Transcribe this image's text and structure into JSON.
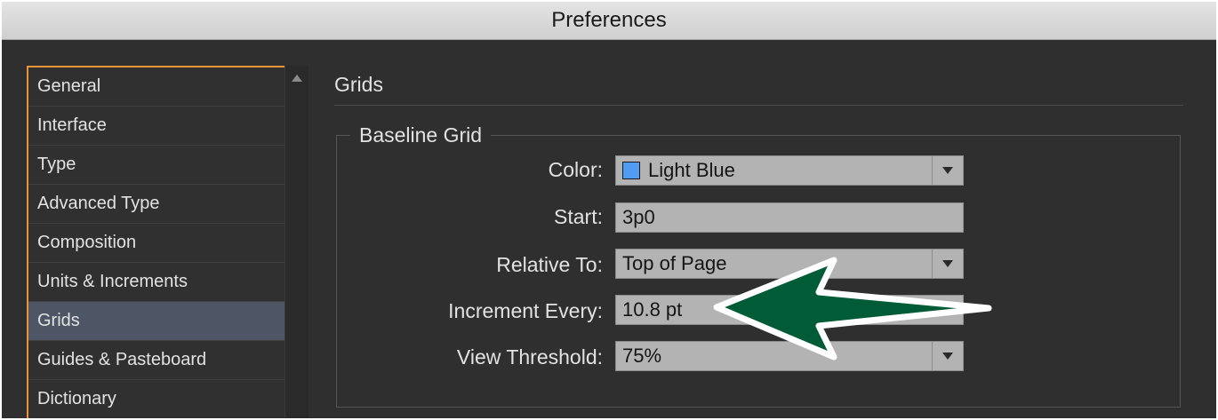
{
  "window": {
    "title": "Preferences"
  },
  "sidebar": {
    "items": [
      {
        "label": "General"
      },
      {
        "label": "Interface"
      },
      {
        "label": "Type"
      },
      {
        "label": "Advanced Type"
      },
      {
        "label": "Composition"
      },
      {
        "label": "Units & Increments"
      },
      {
        "label": "Grids"
      },
      {
        "label": "Guides & Pasteboard"
      },
      {
        "label": "Dictionary"
      }
    ],
    "selected": "Grids"
  },
  "panel": {
    "title": "Grids",
    "group_title": "Baseline Grid",
    "fields": {
      "color": {
        "label": "Color:",
        "value": "Light Blue",
        "swatch_color": "#4f9cf2"
      },
      "start": {
        "label": "Start:",
        "value": "3p0"
      },
      "relative_to": {
        "label": "Relative To:",
        "value": "Top of Page"
      },
      "increment_every": {
        "label": "Increment Every:",
        "value": "10.8 pt"
      },
      "view_threshold": {
        "label": "View Threshold:",
        "value": "75%"
      }
    }
  },
  "annotation": {
    "arrow_color": "#005c36"
  }
}
